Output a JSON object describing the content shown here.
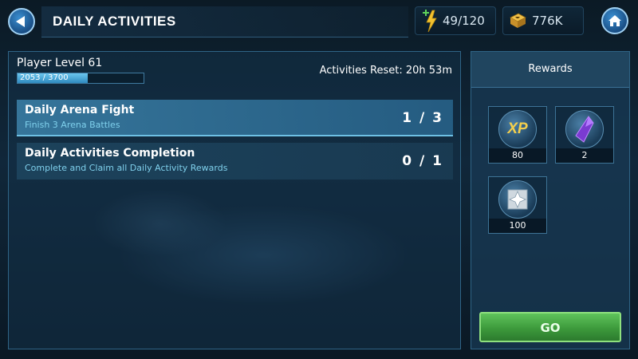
{
  "header": {
    "title": "DAILY ACTIVITIES",
    "energy": "49/120",
    "credits": "776K",
    "icons": {
      "back": "back-arrow-icon",
      "home": "home-icon",
      "energy": "lightning-bolt-icon",
      "credits": "credit-chip-icon"
    }
  },
  "player": {
    "level_label": "Player Level 61",
    "xp_text": "2053 / 3700",
    "xp_fraction": 0.555
  },
  "reset_label": "Activities Reset: 20h 53m",
  "activities": [
    {
      "title": "Daily Arena Fight",
      "description": "Finish 3 Arena Battles",
      "progress": "1 / 3"
    },
    {
      "title": "Daily Activities Completion",
      "description": "Complete and Claim all Daily Activity Rewards",
      "progress": "0 / 1"
    }
  ],
  "rewards": {
    "title": "Rewards",
    "items": [
      {
        "icon": "xp-icon",
        "text": "XP",
        "quantity": "80"
      },
      {
        "icon": "purple-shard-icon",
        "quantity": "2"
      },
      {
        "icon": "ally-point-crystal-icon",
        "quantity": "100"
      }
    ],
    "go_label": "GO"
  },
  "colors": {
    "accent": "#3a8ed0",
    "progress": "#6cc6ee",
    "go": "#4caf50",
    "desc": "#7fd0ec"
  }
}
